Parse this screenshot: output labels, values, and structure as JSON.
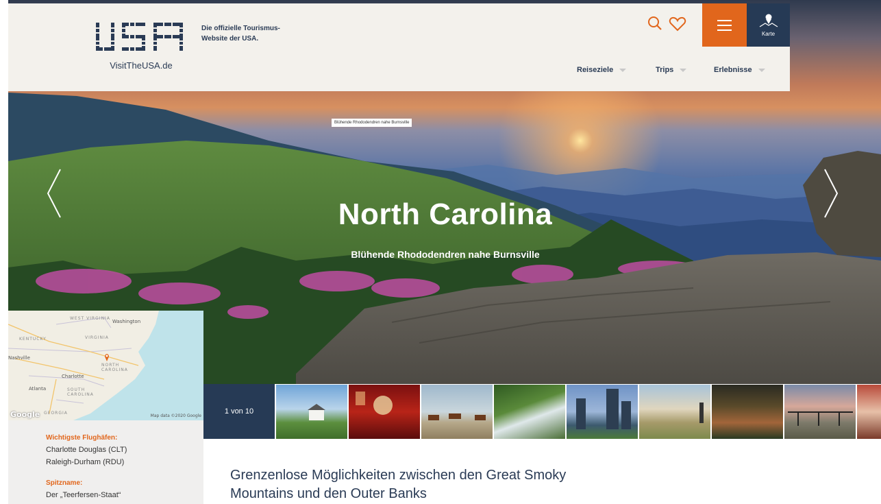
{
  "header": {
    "logo_text": "VisitTheUSA.de",
    "tagline": "Die offizielle Tourismus-Website der USA.",
    "map_button_label": "Karte",
    "nav": [
      {
        "label": "Reiseziele"
      },
      {
        "label": "Trips"
      },
      {
        "label": "Erlebnisse"
      }
    ]
  },
  "hero": {
    "caption_tag": "Blühende Rhododendren nahe Burnsville",
    "title": "North Carolina",
    "subtitle": "Blühende Rhododendren nahe Burnsville"
  },
  "map": {
    "labels": {
      "west_virginia": "WEST VIRGINIA",
      "washington": "Washington",
      "kentucky": "KENTUCKY",
      "virginia": "VIRGINIA",
      "nashville": "Nashville",
      "north_carolina": "NORTH CAROLINA",
      "charlotte": "Charlotte",
      "atlanta": "Atlanta",
      "south_carolina": "SOUTH CAROLINA",
      "georgia": "GEORGIA"
    },
    "google": "Google",
    "attribution": "Map data ©2020 Google"
  },
  "info": {
    "airports_heading": "Wichtigste Flughäfen:",
    "airports": [
      "Charlotte Douglas (CLT)",
      "Raleigh-Durham (RDU)"
    ],
    "nickname_heading": "Spitzname:",
    "nickname": "Der „Teerfersen-Staat“"
  },
  "gallery": {
    "counter": "1 von 10"
  },
  "main": {
    "headline_line1": "Grenzenlose Möglichkeiten zwischen den Great Smoky",
    "headline_line2": "Mountains und den Outer Banks"
  },
  "colors": {
    "accent_orange": "#e1661c",
    "navy": "#263a55"
  }
}
